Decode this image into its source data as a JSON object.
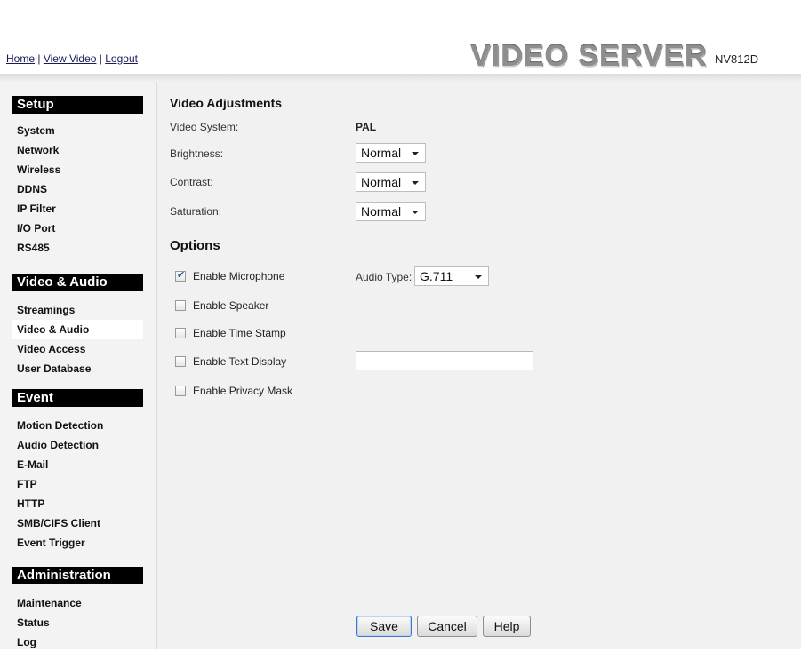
{
  "header": {
    "nav": [
      "Home",
      "View Video",
      "Logout"
    ],
    "separator": "|",
    "brand": "VIDEO SERVER",
    "model": "NV812D"
  },
  "sidebar": {
    "sections": [
      {
        "title": "Setup",
        "items": [
          "System",
          "Network",
          "Wireless",
          "DDNS",
          "IP Filter",
          "I/O Port",
          "RS485"
        ]
      },
      {
        "title": "Video & Audio",
        "items": [
          "Streamings",
          "Video & Audio",
          "Video Access",
          "User Database"
        ]
      },
      {
        "title": "Event",
        "items": [
          "Motion Detection",
          "Audio Detection",
          "E-Mail",
          "FTP",
          "HTTP",
          "SMB/CIFS Client",
          "Event Trigger"
        ]
      },
      {
        "title": "Administration",
        "items": [
          "Maintenance",
          "Status",
          "Log"
        ]
      }
    ],
    "active_item": "Video & Audio"
  },
  "main": {
    "video_adjustments": {
      "title": "Video Adjustments",
      "video_system_label": "Video System:",
      "video_system_value": "PAL",
      "brightness_label": "Brightness:",
      "brightness_value": "Normal",
      "contrast_label": "Contrast:",
      "contrast_value": "Normal",
      "saturation_label": "Saturation:",
      "saturation_value": "Normal"
    },
    "options": {
      "title": "Options",
      "microphone_label": "Enable Microphone",
      "microphone_checked": true,
      "audio_type_label": "Audio Type:",
      "audio_type_value": "G.711",
      "speaker_label": "Enable Speaker",
      "time_stamp_label": "Enable Time Stamp",
      "text_display_label": "Enable Text Display",
      "text_display_value": "",
      "privacy_mask_label": "Enable Privacy Mask"
    },
    "buttons": {
      "save": "Save",
      "cancel": "Cancel",
      "help": "Help"
    }
  }
}
